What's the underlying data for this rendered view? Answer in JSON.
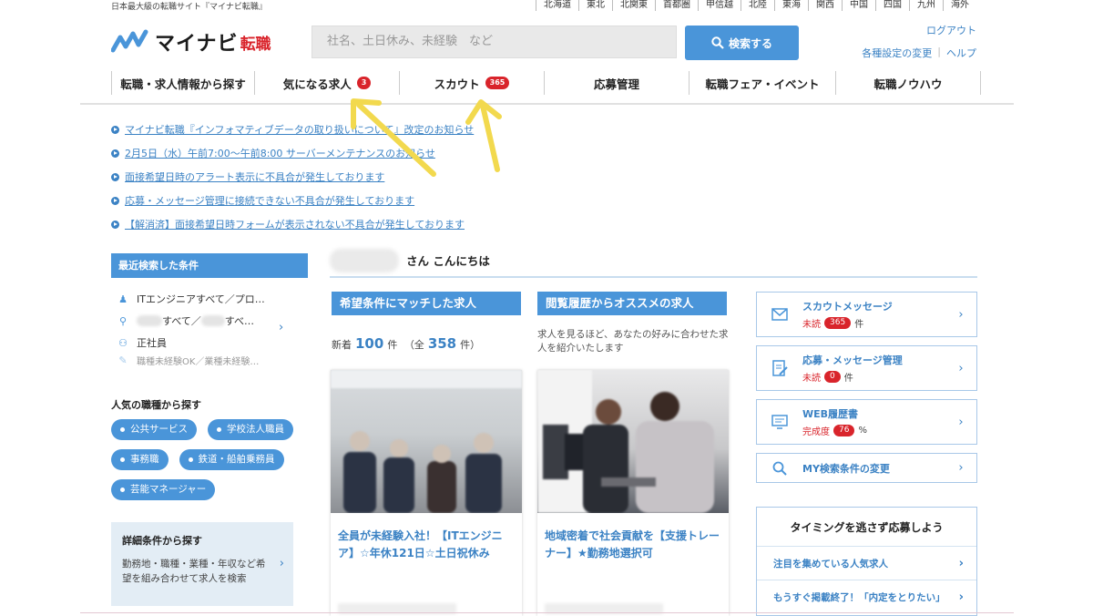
{
  "header": {
    "tagline": "日本最大級の転職サイト『マイナビ転職』",
    "regions": [
      "北海道",
      "東北",
      "北関東",
      "首都圏",
      "甲信越",
      "北陸",
      "東海",
      "関西",
      "中国",
      "四国",
      "九州",
      "海外"
    ],
    "logo_text": "マイナビ",
    "logo_sub": "転職",
    "search_placeholder": "社名、土日休み、未経験　など",
    "search_button": "検索する",
    "logout": "ログアウト",
    "settings_link": "各種設定の変更",
    "help_link": "ヘルプ"
  },
  "nav": [
    {
      "label": "転職・求人情報から探す",
      "badge": ""
    },
    {
      "label": "気になる求人",
      "badge": "3"
    },
    {
      "label": "スカウト",
      "badge": "365"
    },
    {
      "label": "応募管理",
      "badge": ""
    },
    {
      "label": "転職フェア・イベント",
      "badge": ""
    },
    {
      "label": "転職ノウハウ",
      "badge": ""
    }
  ],
  "notices": [
    "マイナビ転職『インフォマティブデータの取り扱いについて』改定のお知らせ",
    "2月5日（水）午前7:00～午前8:00 サーバーメンテナンスのお知らせ",
    "面接希望日時のアラート表示に不具合が発生しております",
    "応募・メッセージ管理に接続できない不具合が発生しております",
    "【解消済】面接希望日時フォームが表示されない不具合が発生しております"
  ],
  "recent": {
    "title": "最近検索した条件",
    "job": "ITエンジニアすべて／プロ…",
    "location_mid": "すべて／",
    "location_end": "すべ…",
    "employment": "正社員",
    "extra": "職種未経験OK／業種未経験…"
  },
  "popular": {
    "title": "人気の職種から探す",
    "tags": [
      "公共サービス",
      "学校法人職員",
      "事務職",
      "鉄道・船舶乗務員",
      "芸能マネージャー"
    ]
  },
  "detail": {
    "title": "詳細条件から探す",
    "desc": "勤務地・職種・業種・年収など希望を組み合わせて求人を検索"
  },
  "greeting": "さん こんにちは",
  "match": {
    "title": "希望条件にマッチした求人",
    "new_label": "新着",
    "new_count": "100",
    "unit": "件",
    "total_label": "（全",
    "total_count": "358",
    "total_unit": "件）",
    "card_title": "全員が未経験入社！【ITエンジニア】☆年休121日☆土日祝休み"
  },
  "history": {
    "title": "閲覧履歴からオススメの求人",
    "desc": "求人を見るほど、あなたの好みに合わせた求人を紹介いたします",
    "card_title": "地域密着で社会貢献を【支援トレーナー】★勤務地選択可"
  },
  "right": {
    "scout": {
      "title": "スカウトメッセージ",
      "status": "未読",
      "count": "365",
      "unit": "件"
    },
    "apply": {
      "title": "応募・メッセージ管理",
      "status": "未読",
      "count": "0",
      "unit": "件"
    },
    "resume": {
      "title": "WEB履歴書",
      "status": "完成度",
      "count": "76",
      "unit": "%"
    },
    "mysearch": {
      "title": "MY検索条件の変更"
    },
    "timing": {
      "title": "タイミングを逃さず応募しよう",
      "row1": "注目を集めている人気求人",
      "row2": "もうすぐ掲載終了！「内定をとりたい」"
    }
  },
  "colors": {
    "accent": "#4a95d9",
    "link": "#3b82c4",
    "badge": "#d9242b",
    "arrow": "#f2d94e"
  }
}
